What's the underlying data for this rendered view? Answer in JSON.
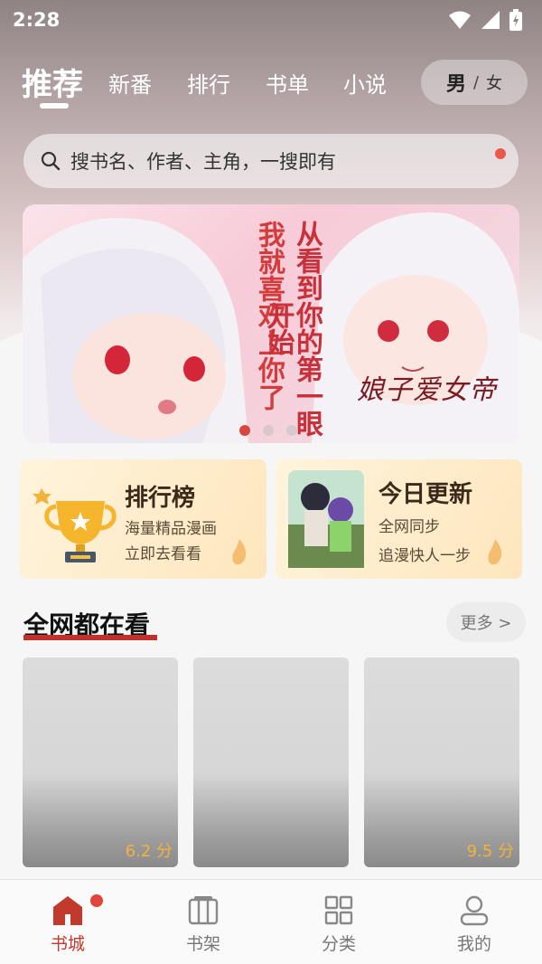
{
  "status_bar": {
    "time": "2:28",
    "icons": [
      "wifi-icon",
      "cell-signal-icon",
      "battery-charging-icon"
    ]
  },
  "top_nav": {
    "tabs": [
      {
        "label": "推荐",
        "active": true
      },
      {
        "label": "新番",
        "active": false
      },
      {
        "label": "排行",
        "active": false
      },
      {
        "label": "书单",
        "active": false
      },
      {
        "label": "小说",
        "active": false
      }
    ],
    "gender": {
      "male": "男",
      "separator": "/",
      "female": "女"
    }
  },
  "search": {
    "placeholder": "搜书名、作者、主角，一搜即有",
    "icon": "search-icon"
  },
  "banner": {
    "caption_1": "我就喜欢上你了",
    "caption_2": "从看到你的第一眼开始",
    "logo_text": "娘子爱女帝",
    "active_index": 0,
    "dot_count": 3
  },
  "feature_cards": {
    "ranking": {
      "title": "排行榜",
      "line_1": "海量精品漫画",
      "line_2": "立即去看看",
      "icon": "trophy-icon"
    },
    "update": {
      "title": "今日更新",
      "line_1": "全网同步",
      "line_2": "追漫快人一步"
    }
  },
  "section": {
    "title": "全网都在看",
    "more_label": "更多 >"
  },
  "books": [
    {
      "score": "6.2 分"
    },
    {
      "score": ""
    },
    {
      "score": "9.5 分"
    }
  ],
  "bottom_nav": {
    "items": [
      {
        "label": "书城",
        "icon": "home-icon",
        "active": true,
        "badge": true
      },
      {
        "label": "书架",
        "icon": "bookshelf-icon",
        "active": false
      },
      {
        "label": "分类",
        "icon": "category-grid-icon",
        "active": false
      },
      {
        "label": "我的",
        "icon": "profile-icon",
        "active": false
      }
    ]
  },
  "colors": {
    "accent": "#c23a2c",
    "badge": "#e0443a",
    "score": "#f3b23c"
  }
}
